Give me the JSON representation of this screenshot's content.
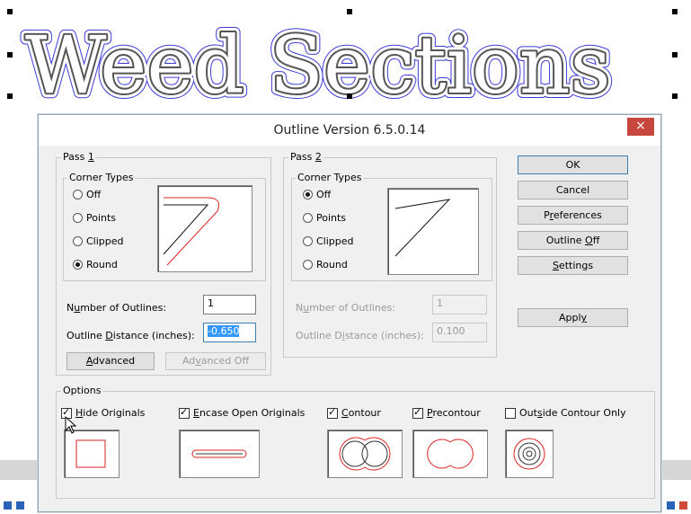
{
  "canvas": {
    "text": "Weed Sections"
  },
  "dialog": {
    "title": "Outline Version 6.5.0.14",
    "close": "×",
    "pass1": {
      "label": "Pass 1",
      "corner_types_label": "Corner Types",
      "options": [
        "Off",
        "Points",
        "Clipped",
        "Round"
      ],
      "selected": "Round",
      "number_label": "Number of Outlines:",
      "number_value": "1",
      "distance_label": "Outline Distance (inches):",
      "distance_value": "-0.650",
      "advanced": "Advanced",
      "advanced_off": "Advanced Off"
    },
    "pass2": {
      "label": "Pass 2",
      "corner_types_label": "Corner Types",
      "options": [
        "Off",
        "Points",
        "Clipped",
        "Round"
      ],
      "selected": "Off",
      "number_label": "Number of Outlines:",
      "number_value": "1",
      "distance_label": "Outline Distance (inches):",
      "distance_value": "0.100"
    },
    "buttons": {
      "ok": "OK",
      "cancel": "Cancel",
      "preferences": "Preferences",
      "outline_off": "Outline Off",
      "settings": "Settings",
      "apply": "Apply"
    },
    "options_group": {
      "label": "Options",
      "items": [
        {
          "label": "Hide Originals",
          "checked": true
        },
        {
          "label": "Encase Open Originals",
          "checked": true
        },
        {
          "label": "Contour",
          "checked": true
        },
        {
          "label": "Precontour",
          "checked": true
        },
        {
          "label": "Outside Contour Only",
          "checked": false
        }
      ]
    }
  }
}
